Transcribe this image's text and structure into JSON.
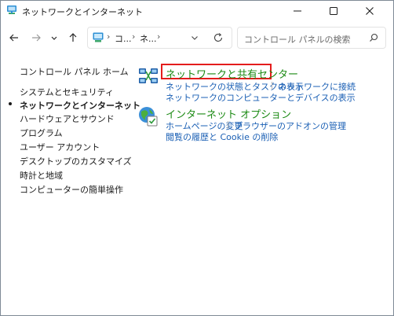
{
  "window": {
    "title": "ネットワークとインターネット"
  },
  "navigation": {
    "breadcrumbs": [
      "コ...",
      "ネ..."
    ],
    "search_placeholder": "コントロール パネルの検索"
  },
  "sidebar": {
    "items": [
      {
        "label": "コントロール パネル ホーム",
        "active": false
      },
      {
        "label": "システムとセキュリティ",
        "active": false
      },
      {
        "label": "ネットワークとインターネット",
        "active": true
      },
      {
        "label": "ハードウェアとサウンド",
        "active": false
      },
      {
        "label": "プログラム",
        "active": false
      },
      {
        "label": "ユーザー アカウント",
        "active": false
      },
      {
        "label": "デスクトップのカスタマイズ",
        "active": false
      },
      {
        "label": "時計と地域",
        "active": false
      },
      {
        "label": "コンピューターの簡単操作",
        "active": false
      }
    ]
  },
  "categories": [
    {
      "title": "ネットワークと共有センター",
      "icon": "network-sharing-center-icon",
      "highlighted": true,
      "tasks": [
        "ネットワークの状態とタスクの表示",
        "ネットワークに接続",
        "ネットワークのコンピューターとデバイスの表示"
      ]
    },
    {
      "title": "インターネット オプション",
      "icon": "internet-options-icon",
      "highlighted": false,
      "tasks": [
        "ホームページの変更",
        "ブラウザーのアドオンの管理",
        "閲覧の履歴と Cookie の削除"
      ]
    }
  ],
  "colors": {
    "category_title": "#1c8a14",
    "task_link": "#1a5fb4",
    "highlight_border": "#e41c1c"
  }
}
